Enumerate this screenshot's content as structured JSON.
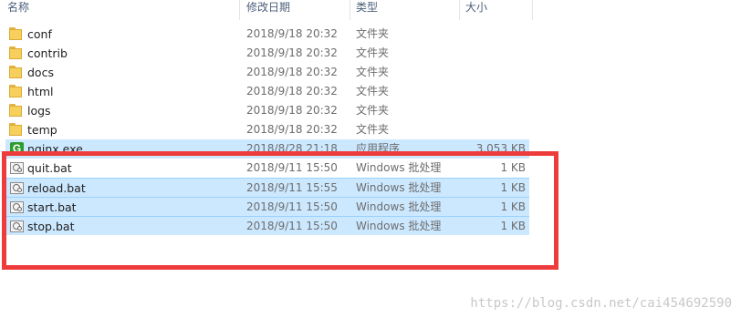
{
  "header": {
    "name": "名称",
    "date": "修改日期",
    "type": "类型",
    "size": "大小"
  },
  "rows": [
    {
      "icon": "folder-icon",
      "name": "conf",
      "date": "2018/9/18 20:32",
      "type": "文件夹",
      "size": ""
    },
    {
      "icon": "folder-icon",
      "name": "contrib",
      "date": "2018/9/18 20:32",
      "type": "文件夹",
      "size": ""
    },
    {
      "icon": "folder-icon",
      "name": "docs",
      "date": "2018/9/18 20:32",
      "type": "文件夹",
      "size": ""
    },
    {
      "icon": "folder-icon",
      "name": "html",
      "date": "2018/9/18 20:32",
      "type": "文件夹",
      "size": ""
    },
    {
      "icon": "folder-icon",
      "name": "logs",
      "date": "2018/9/18 20:32",
      "type": "文件夹",
      "size": ""
    },
    {
      "icon": "folder-icon",
      "name": "temp",
      "date": "2018/9/18 20:32",
      "type": "文件夹",
      "size": ""
    },
    {
      "icon": "nginx-app-icon",
      "name": "nginx.exe",
      "date": "2018/8/28 21:18",
      "type": "应用程序",
      "size": "3,053 KB"
    },
    {
      "icon": "batch-file-icon",
      "name": "quit.bat",
      "date": "2018/9/11 15:50",
      "type": "Windows 批处理",
      "size": "1 KB"
    },
    {
      "icon": "batch-file-icon",
      "name": "reload.bat",
      "date": "2018/9/11 15:55",
      "type": "Windows 批处理",
      "size": "1 KB"
    },
    {
      "icon": "batch-file-icon",
      "name": "start.bat",
      "date": "2018/9/11 15:50",
      "type": "Windows 批处理",
      "size": "1 KB"
    },
    {
      "icon": "batch-file-icon",
      "name": "stop.bat",
      "date": "2018/9/11 15:50",
      "type": "Windows 批处理",
      "size": "1 KB"
    }
  ],
  "nginx_glyph": "G",
  "watermark": "https://blog.csdn.net/cai454692590",
  "colors": {
    "selection": "#cce8ff",
    "annotation_box": "#ee3b3b"
  }
}
